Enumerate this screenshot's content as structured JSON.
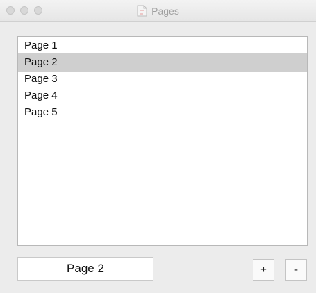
{
  "window": {
    "title": "Pages",
    "title_icon": "document-icon"
  },
  "pages_list": {
    "items": [
      {
        "label": "Page 1",
        "selected": false
      },
      {
        "label": "Page 2",
        "selected": true
      },
      {
        "label": "Page 3",
        "selected": false
      },
      {
        "label": "Page 4",
        "selected": false
      },
      {
        "label": "Page 5",
        "selected": false
      }
    ]
  },
  "page_name_field": {
    "value": "Page 2"
  },
  "buttons": {
    "add_label": "+",
    "remove_label": "-"
  },
  "colors": {
    "selection": "#cfcfcf",
    "window_bg": "#ececec"
  }
}
